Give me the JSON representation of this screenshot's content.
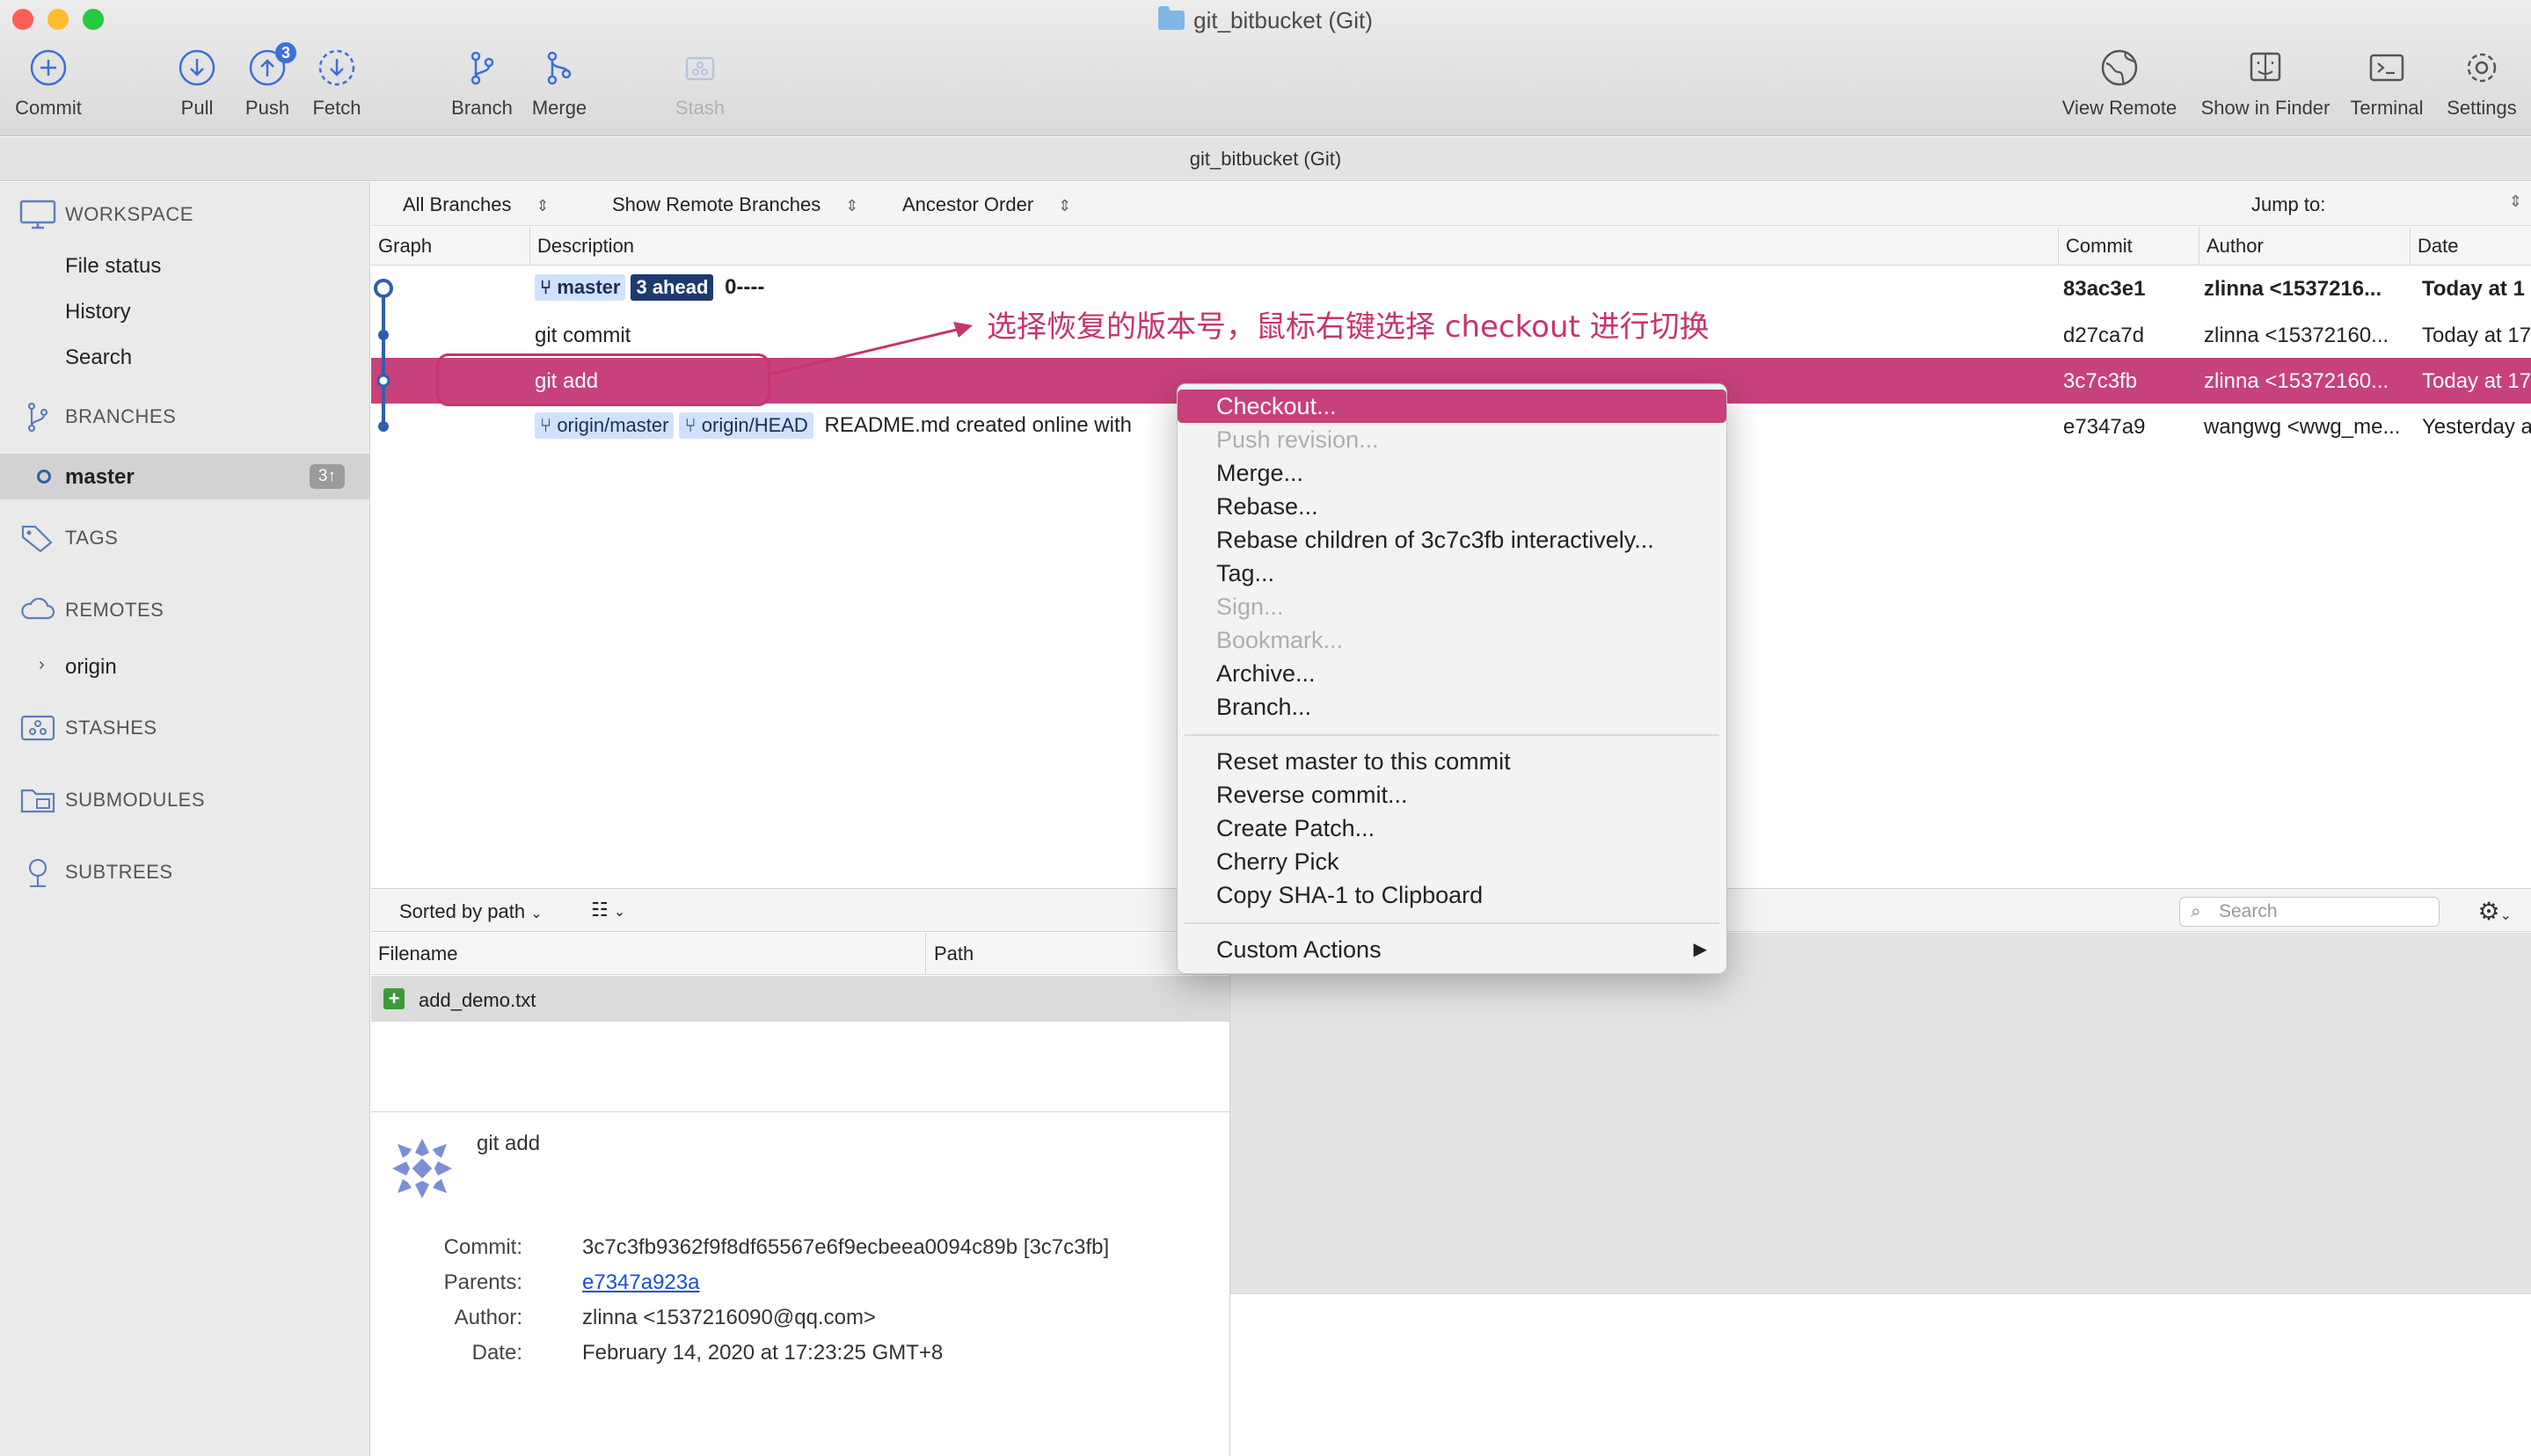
{
  "window": {
    "title": "git_bitbucket (Git)",
    "subtitle": "git_bitbucket (Git)"
  },
  "toolbar": {
    "commit": "Commit",
    "pull": "Pull",
    "push": "Push",
    "push_badge": "3",
    "fetch": "Fetch",
    "branch": "Branch",
    "merge": "Merge",
    "stash": "Stash",
    "view_remote": "View Remote",
    "show_in_finder": "Show in Finder",
    "terminal": "Terminal",
    "settings": "Settings"
  },
  "sidebar": {
    "workspace": "WORKSPACE",
    "file_status": "File status",
    "history": "History",
    "search": "Search",
    "branches": "BRANCHES",
    "master": "master",
    "master_ahead": "3↑",
    "tags": "TAGS",
    "remotes": "REMOTES",
    "origin": "origin",
    "stashes": "STASHES",
    "submodules": "SUBMODULES",
    "subtrees": "SUBTREES"
  },
  "filters": {
    "branches": "All Branches",
    "remote": "Show Remote Branches",
    "order": "Ancestor Order",
    "jump_to": "Jump to:"
  },
  "columns": {
    "graph": "Graph",
    "description": "Description",
    "commit": "Commit",
    "author": "Author",
    "date": "Date"
  },
  "commits": [
    {
      "tag1": "master",
      "tag2": "3 ahead",
      "desc": "0----",
      "hash": "83ac3e1",
      "author": "zlinna <1537216...",
      "date": "Today at 1"
    },
    {
      "desc": "git commit",
      "hash": "d27ca7d",
      "author": "zlinna <15372160...",
      "date": "Today at 17"
    },
    {
      "desc": "git add",
      "hash": "3c7c3fb",
      "author": "zlinna <15372160...",
      "date": "Today at 17"
    },
    {
      "tag1": "origin/master",
      "tag2": "origin/HEAD",
      "desc": "README.md created online with",
      "hash": "e7347a9",
      "author": "wangwg <wwg_me...",
      "date": "Yesterday a"
    }
  ],
  "annotation": "选择恢复的版本号，鼠标右键选择 checkout 进行切换",
  "context_menu": {
    "checkout": "Checkout...",
    "push_revision": "Push revision...",
    "merge": "Merge...",
    "rebase": "Rebase...",
    "rebase_children": "Rebase children of 3c7c3fb interactively...",
    "tag": "Tag...",
    "sign": "Sign...",
    "bookmark": "Bookmark...",
    "archive": "Archive...",
    "branch": "Branch...",
    "reset": "Reset master to this commit",
    "reverse": "Reverse commit...",
    "create_patch": "Create Patch...",
    "cherry_pick": "Cherry Pick",
    "copy_sha": "Copy SHA-1 to Clipboard",
    "custom_actions": "Custom Actions"
  },
  "files": {
    "sorted_by": "Sorted by path",
    "col_filename": "Filename",
    "col_path": "Path",
    "file_name": "add_demo.txt",
    "search_placeholder": "Search"
  },
  "details": {
    "message": "git add",
    "commit_label": "Commit:",
    "commit_value": "3c7c3fb9362f9f8df65567e6f9ecbeea0094c89b [3c7c3fb]",
    "parents_label": "Parents:",
    "parents_value": "e7347a923a",
    "author_label": "Author:",
    "author_value": "zlinna <1537216090@qq.com>",
    "date_label": "Date:",
    "date_value": "February 14, 2020 at 17:23:25 GMT+8"
  },
  "colors": {
    "accent": "#c7417b",
    "annotation": "#c6346e",
    "branch_blue": "#2f5faa"
  }
}
